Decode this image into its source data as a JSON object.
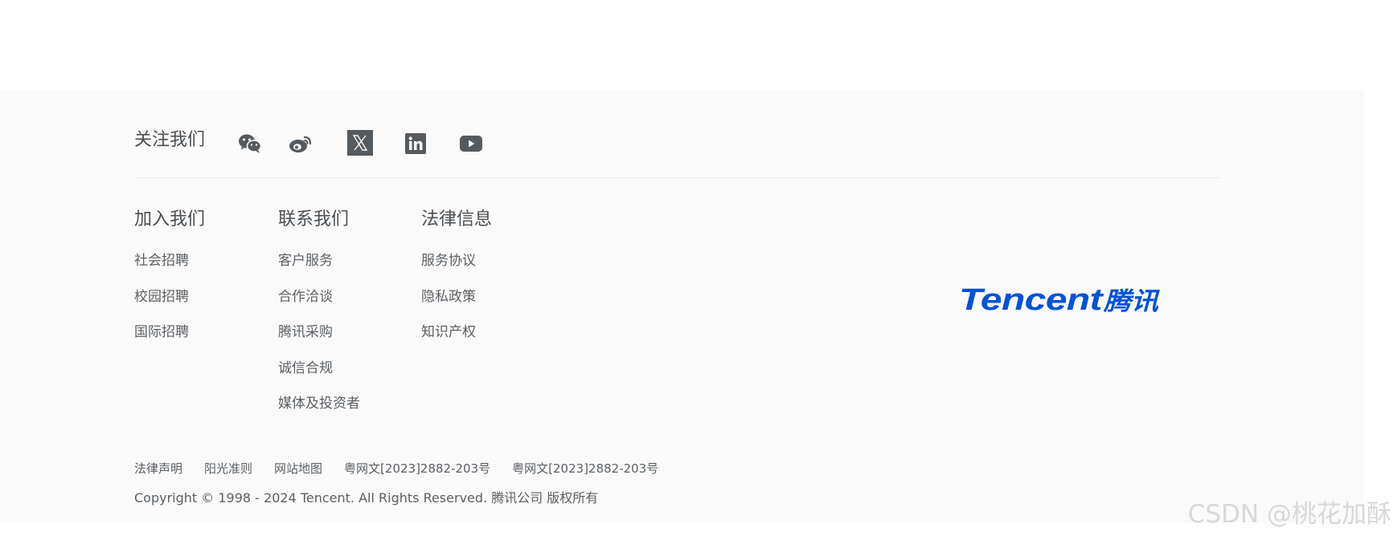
{
  "follow": {
    "title": "关注我们",
    "icons": [
      "wechat-icon",
      "weibo-icon",
      "x-icon",
      "linkedin-icon",
      "youtube-icon"
    ]
  },
  "columns": [
    {
      "title": "加入我们",
      "links": [
        "社会招聘",
        "校园招聘",
        "国际招聘"
      ]
    },
    {
      "title": "联系我们",
      "links": [
        "客户服务",
        "合作洽谈",
        "腾讯采购",
        "诚信合规",
        "媒体及投资者"
      ]
    },
    {
      "title": "法律信息",
      "links": [
        "服务协议",
        "隐私政策",
        "知识产权"
      ]
    }
  ],
  "logo": {
    "en": "Tencent",
    "zh": "腾讯",
    "color": "#0052d9"
  },
  "bottom_links": [
    "法律声明",
    "阳光准则",
    "网站地图",
    "粤网文[2023]2882-203号",
    "粤网文[2023]2882-203号"
  ],
  "copyright": "Copyright © 1998 - 2024 Tencent. All Rights Reserved. 腾讯公司 版权所有",
  "watermark": "CSDN @桃花加酥",
  "colors": {
    "icon": "#555a5e",
    "footer_bg": "#fafafa"
  }
}
